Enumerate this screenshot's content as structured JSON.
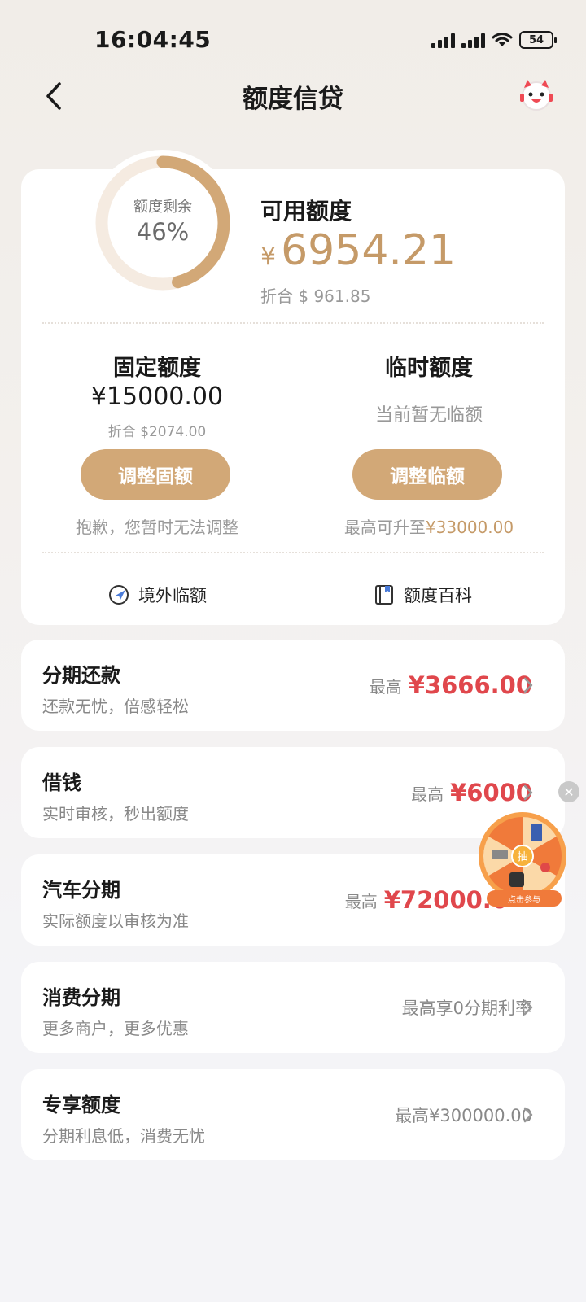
{
  "status_bar": {
    "time": "16:04:45",
    "battery": "54"
  },
  "nav": {
    "title": "额度信贷"
  },
  "summary": {
    "donut_label": "额度剩余",
    "donut_percent_text": "46%",
    "donut_fraction": 0.46,
    "available_title": "可用额度",
    "available_currency": "¥",
    "available_amount": "6954.21",
    "available_usd": "折合 $ 961.85"
  },
  "fixed": {
    "title": "固定额度",
    "amount": "¥15000.00",
    "usd": "折合 $2074.00",
    "button": "调整固额",
    "note": "抱歉，您暂时无法调整"
  },
  "temporary": {
    "title": "临时额度",
    "status": "当前暂无临额",
    "button": "调整临额",
    "note_prefix": "最高可升至",
    "note_amount": "¥33000.00"
  },
  "quick_links": {
    "overseas": "境外临额",
    "encyclopedia": "额度百科"
  },
  "products": [
    {
      "title": "分期还款",
      "subtitle": "还款无忧，倍感轻松",
      "prefix": "最高",
      "amount": "¥3666.00"
    },
    {
      "title": "借钱",
      "subtitle": "实时审核，秒出额度",
      "prefix": "最高",
      "amount": "¥6000"
    },
    {
      "title": "汽车分期",
      "subtitle": "实际额度以审核为准",
      "prefix": "最高",
      "amount": "¥72000.0"
    },
    {
      "title": "消费分期",
      "subtitle": "更多商户，更多优惠",
      "plain": "最高享0分期利率"
    },
    {
      "title": "专享额度",
      "subtitle": "分期利息低，消费无忧",
      "plain": "最高¥300000.00"
    }
  ],
  "floating_widget": {
    "center": "抽",
    "button": "点击参与"
  },
  "colors": {
    "accent_gold": "#c59a68",
    "button_gold": "#d2a877",
    "amount_red": "#e0474c",
    "wheel_orange": "#f07a3a"
  }
}
